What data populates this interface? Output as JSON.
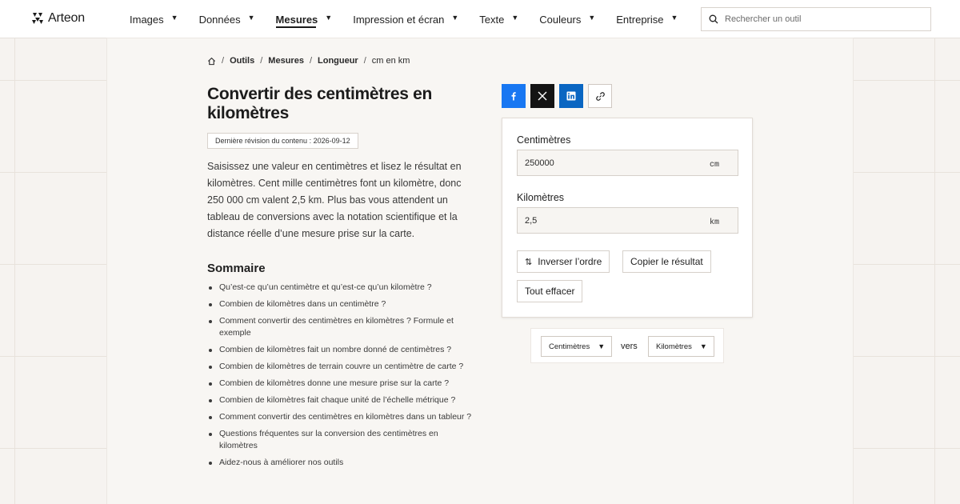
{
  "brand": {
    "name": "Arteon"
  },
  "nav": {
    "items": [
      {
        "label": "Images",
        "active": false
      },
      {
        "label": "Données",
        "active": false
      },
      {
        "label": "Mesures",
        "active": true
      },
      {
        "label": "Impression et écran",
        "active": false
      },
      {
        "label": "Texte",
        "active": false
      },
      {
        "label": "Couleurs",
        "active": false
      },
      {
        "label": "Entreprise",
        "active": false
      }
    ],
    "caret": "▼"
  },
  "search": {
    "placeholder": "Rechercher un outil"
  },
  "breadcrumb": {
    "items": [
      "Outils",
      "Mesures",
      "Longueur"
    ],
    "current": "cm en km",
    "separator": "/"
  },
  "page": {
    "title": "Convertir des centimètres en kilomètres",
    "revision": "Dernière révision du contenu : 2026-09-12",
    "intro": "Saisissez une valeur en centimètres et lisez le résultat en kilomètres. Cent mille centimètres font un kilomètre, donc 250 000 cm valent 2,5 km. Plus bas vous attendent un tableau de conversions avec la notation scientifique et la distance réelle d’une mesure prise sur la carte."
  },
  "toc": {
    "title": "Sommaire",
    "items": [
      "Qu’est-ce qu’un centimètre et qu’est-ce qu’un kilomètre ?",
      "Combien de kilomètres dans un centimètre ?",
      "Comment convertir des centimètres en kilomètres ? Formule et exemple",
      "Combien de kilomètres fait un nombre donné de centimètres ?",
      "Combien de kilomètres de terrain couvre un centimètre de carte ?",
      "Combien de kilomètres donne une mesure prise sur la carte ?",
      "Combien de kilomètres fait chaque unité de l’échelle métrique ?",
      "Comment convertir des centimètres en kilomètres dans un tableur ?",
      "Questions fréquentes sur la conversion des centimètres en kilomètres",
      "Aidez-nous à améliorer nos outils"
    ]
  },
  "share": {
    "icons": [
      "facebook-icon",
      "x-icon",
      "linkedin-icon",
      "link-icon"
    ],
    "colors": {
      "facebook": "#1877f2",
      "x": "#141414",
      "linkedin": "#0a66c2"
    }
  },
  "converter": {
    "from_label": "Centimètres",
    "from_value": "250000",
    "from_unit": "cm",
    "to_label": "Kilomètres",
    "to_value": "2,5",
    "to_unit": "km",
    "swap_icon": "⇅",
    "swap_label": "Inverser l’ordre",
    "copy_label": "Copier le résultat",
    "clear_label": "Tout effacer"
  },
  "unit_selector": {
    "from": "Centimètres",
    "connector": "vers",
    "to": "Kilomètres",
    "caret": "▼"
  }
}
